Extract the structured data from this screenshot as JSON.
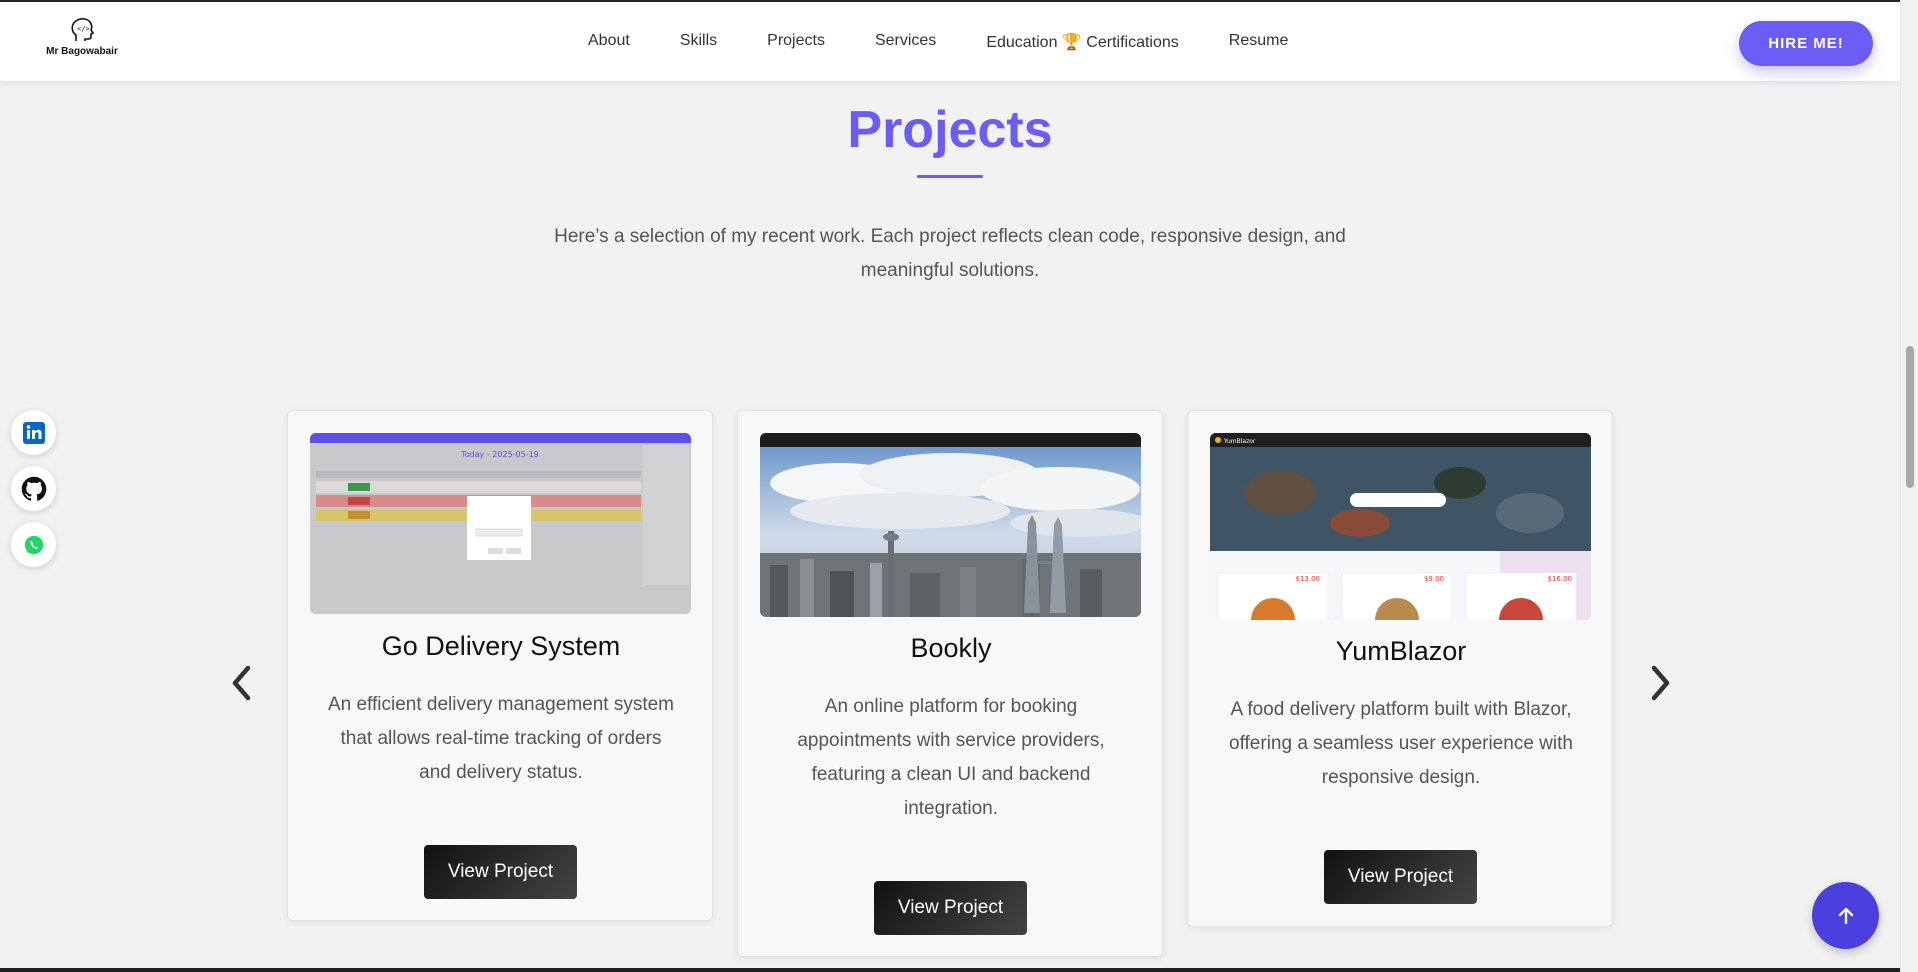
{
  "nav": {
    "logo_text": "Mr Bagowabair",
    "links": [
      "About",
      "Skills",
      "Projects",
      "Services",
      "Education 🏆 Certifications",
      "Resume"
    ],
    "hire_label": "HIRE ME!"
  },
  "section": {
    "title": "Projects",
    "description": "Here’s a selection of my recent work. Each project reflects clean code, responsive design, and meaningful solutions."
  },
  "socials": [
    "linkedin-icon",
    "github-icon",
    "whatsapp-icon"
  ],
  "projects": [
    {
      "title": "Go Delivery System",
      "description": "An efficient delivery management system that allows real-time tracking of orders and delivery status.",
      "button": "View Project",
      "screenshot_heading": "Today - 2025-05-19"
    },
    {
      "title": "Bookly",
      "description": "An online platform for booking appointments with service providers, featuring a clean UI and backend integration.",
      "button": "View Project"
    },
    {
      "title": "YumBlazor",
      "description": "A food delivery platform built with Blazor, offering a seamless user experience with responsive design.",
      "button": "View Project",
      "screenshot_brand": "YumBlazor",
      "screenshot_prices": [
        "$13.00",
        "$9.00",
        "$16.00"
      ]
    }
  ],
  "colors": {
    "accent": "#6a5cf4",
    "to_top": "#4b3fe0",
    "button_dark": "#222222"
  }
}
